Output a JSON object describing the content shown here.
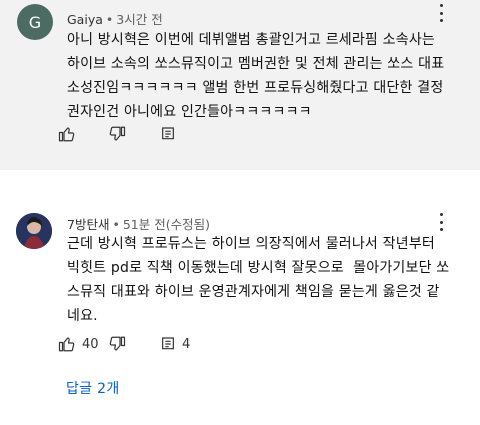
{
  "comments": [
    {
      "author": "Gaiya",
      "time": "3시간 전",
      "edited": "",
      "avatar_letter": "G",
      "lines": [
        "아니 방시혁은 이번에 데뷔앨범 총괄인거고 르세라핌 소속사는",
        "하이브 소속의 쏘스뮤직이고 멤버권한 및 전체 관리는 쏘스 대표",
        "소성진임ㅋㅋㅋㅋㅋㅋ 앨범 한번 프로듀싱해줬다고 대단한 결정",
        "권자인건 아니에요 인간들아ㅋㅋㅋㅋㅋㅋ"
      ],
      "like_count": "",
      "reply_count": ""
    },
    {
      "author": "7방탄새",
      "time": "51분 전",
      "edited": "(수정됨)",
      "avatar_letter": "",
      "lines": [
        "근데 방시혁 프로듀스는 하이브 의장직에서 물러나서 작년부터",
        "빅힛트 pd로 직책 이동했는데 방시혁 잘못으로  몰아가기보단 쏘",
        "스뮤직 대표와 하이브 운영관계자에게 책임을 묻는게 옳은것 같",
        "네요."
      ],
      "like_count": "40",
      "reply_count": "4",
      "view_replies": "답글 2개"
    }
  ],
  "icons": {
    "like": "thumbs-up-icon",
    "dislike": "thumbs-down-icon",
    "reply": "comment-icon",
    "more": "kebab-menu-icon",
    "corner": "search-icon"
  },
  "colors": {
    "link": "#065fd4",
    "muted": "#606060",
    "highlight_bg": "#f2f2f2"
  }
}
